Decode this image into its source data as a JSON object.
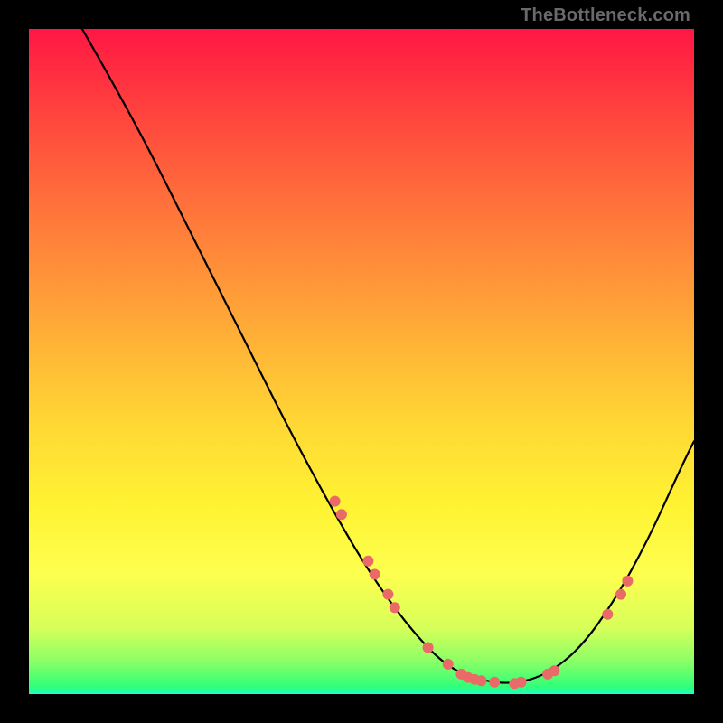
{
  "watermark": "TheBottleneck.com",
  "colors": {
    "marker": "#e96a66",
    "curve": "#000000",
    "gradient_top": "#ff1744",
    "gradient_mid": "#fff333",
    "gradient_bottom": "#1effc8"
  },
  "chart_data": {
    "type": "line",
    "title": "",
    "xlabel": "",
    "ylabel": "",
    "xlim": [
      0,
      100
    ],
    "ylim": [
      0,
      100
    ],
    "curve": [
      {
        "x": 8,
        "y": 100
      },
      {
        "x": 12,
        "y": 93
      },
      {
        "x": 18,
        "y": 82
      },
      {
        "x": 25,
        "y": 68
      },
      {
        "x": 32,
        "y": 54
      },
      {
        "x": 39,
        "y": 40
      },
      {
        "x": 46,
        "y": 27
      },
      {
        "x": 52,
        "y": 17
      },
      {
        "x": 58,
        "y": 9
      },
      {
        "x": 63,
        "y": 4
      },
      {
        "x": 68,
        "y": 2
      },
      {
        "x": 73,
        "y": 1.5
      },
      {
        "x": 78,
        "y": 3
      },
      {
        "x": 83,
        "y": 7
      },
      {
        "x": 88,
        "y": 14
      },
      {
        "x": 93,
        "y": 23
      },
      {
        "x": 98,
        "y": 34
      },
      {
        "x": 100,
        "y": 38
      }
    ],
    "markers": [
      {
        "x": 46,
        "y": 29
      },
      {
        "x": 47,
        "y": 27
      },
      {
        "x": 51,
        "y": 20
      },
      {
        "x": 52,
        "y": 18
      },
      {
        "x": 54,
        "y": 15
      },
      {
        "x": 55,
        "y": 13
      },
      {
        "x": 60,
        "y": 7
      },
      {
        "x": 63,
        "y": 4.5
      },
      {
        "x": 65,
        "y": 3
      },
      {
        "x": 66,
        "y": 2.5
      },
      {
        "x": 67,
        "y": 2.2
      },
      {
        "x": 68,
        "y": 2
      },
      {
        "x": 70,
        "y": 1.8
      },
      {
        "x": 73,
        "y": 1.6
      },
      {
        "x": 74,
        "y": 1.8
      },
      {
        "x": 78,
        "y": 3
      },
      {
        "x": 79,
        "y": 3.5
      },
      {
        "x": 87,
        "y": 12
      },
      {
        "x": 89,
        "y": 15
      },
      {
        "x": 90,
        "y": 17
      }
    ]
  }
}
